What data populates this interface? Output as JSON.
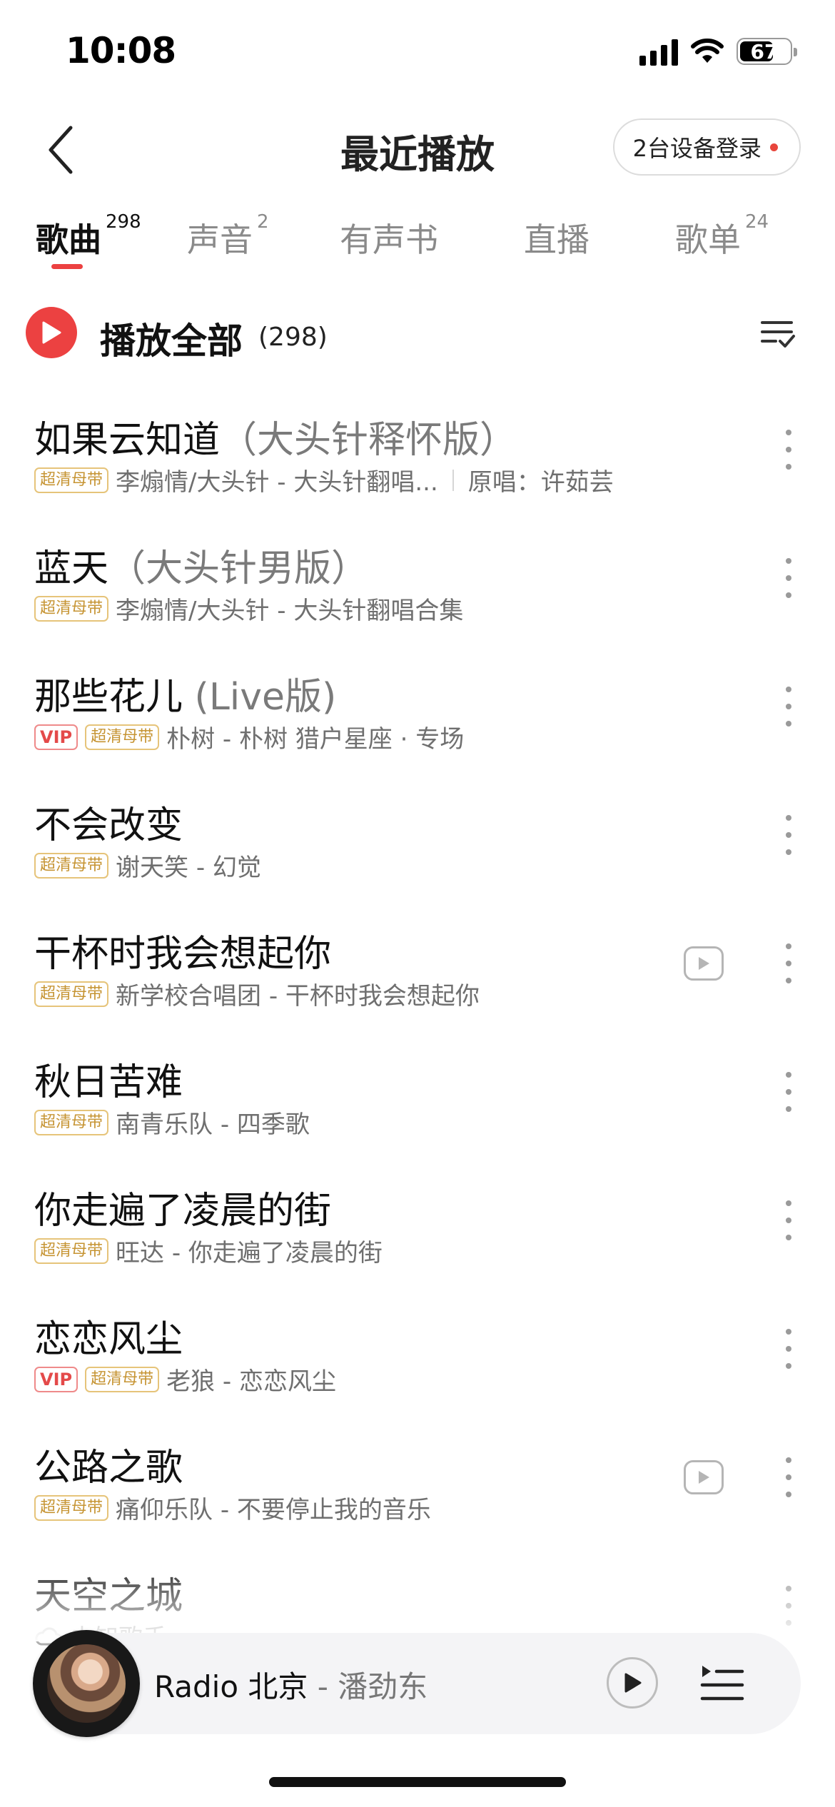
{
  "status_bar": {
    "time": "10:08",
    "battery": "67",
    "battery_fraction": 0.67
  },
  "header": {
    "title": "最近播放",
    "device_login_label": "2台设备登录"
  },
  "tabs": [
    {
      "label": "歌曲",
      "count": "298",
      "active": true
    },
    {
      "label": "声音",
      "count": "2",
      "active": false
    },
    {
      "label": "有声书",
      "count": "",
      "active": false
    },
    {
      "label": "直播",
      "count": "",
      "active": false
    },
    {
      "label": "歌单",
      "count": "24",
      "active": false
    }
  ],
  "play_all": {
    "label": "播放全部",
    "count": "(298)"
  },
  "songs": [
    {
      "title": "如果云知道",
      "subtitle": "（大头针释怀版）",
      "vip": false,
      "hq": true,
      "meta": "李煽情/大头针 - 大头针翻唱...",
      "original": "原唱：许茹芸",
      "mv": false
    },
    {
      "title": "蓝天",
      "subtitle": "（大头针男版）",
      "vip": false,
      "hq": true,
      "meta": "李煽情/大头针 - 大头针翻唱合集",
      "original": "",
      "mv": false
    },
    {
      "title": "那些花儿",
      "subtitle": " (Live版)",
      "vip": true,
      "hq": true,
      "meta": "朴树 - 朴树 猎户星座 · 专场",
      "original": "",
      "mv": false
    },
    {
      "title": "不会改变",
      "subtitle": "",
      "vip": false,
      "hq": true,
      "meta": "谢天笑 - 幻觉",
      "original": "",
      "mv": false
    },
    {
      "title": "干杯时我会想起你",
      "subtitle": "",
      "vip": false,
      "hq": true,
      "meta": "新学校合唱团 - 干杯时我会想起你",
      "original": "",
      "mv": true
    },
    {
      "title": "秋日苦难",
      "subtitle": "",
      "vip": false,
      "hq": true,
      "meta": "南青乐队 - 四季歌",
      "original": "",
      "mv": false
    },
    {
      "title": "你走遍了凌晨的街",
      "subtitle": "",
      "vip": false,
      "hq": true,
      "meta": "旺达 - 你走遍了凌晨的街",
      "original": "",
      "mv": false
    },
    {
      "title": "恋恋风尘",
      "subtitle": "",
      "vip": true,
      "hq": true,
      "meta": "老狼 - 恋恋风尘",
      "original": "",
      "mv": false
    },
    {
      "title": "公路之歌",
      "subtitle": "",
      "vip": false,
      "hq": true,
      "meta": "痛仰乐队 - 不要停止我的音乐",
      "original": "",
      "mv": true
    },
    {
      "title": "天空之城",
      "subtitle": "",
      "vip": false,
      "hq": false,
      "cloud": true,
      "meta": "未知歌手",
      "original": "",
      "mv": false
    }
  ],
  "tags": {
    "hq": "超清母带",
    "vip": "VIP"
  },
  "mini_player": {
    "title": "Radio 北京",
    "separator": " - ",
    "artist": "潘劲东"
  },
  "icons": {
    "back": "chevron-left-icon",
    "sort": "sort-list-icon",
    "play": "play-icon",
    "more": "more-vertical-icon",
    "mv": "video-play-icon",
    "playlist": "playlist-icon",
    "cloud": "cloud-icon"
  },
  "colors": {
    "accent": "#ec4141",
    "hq_tag": "#c69433",
    "vip_tag": "#e44a4a"
  }
}
